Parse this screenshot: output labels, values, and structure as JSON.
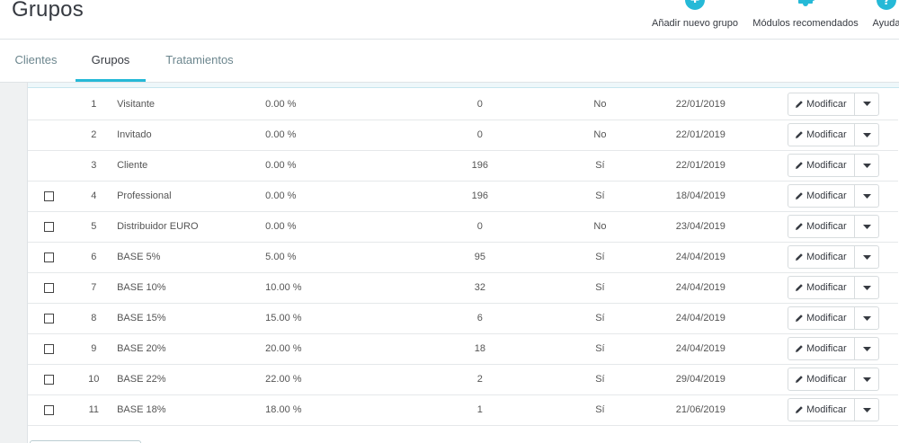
{
  "header": {
    "title": "Grupos",
    "toolbar": [
      {
        "label": "Añadir nuevo grupo",
        "icon": "add-circle-icon"
      },
      {
        "label": "Módulos recomendados",
        "icon": "puzzle-icon"
      },
      {
        "label": "Ayuda",
        "icon": "help-circle-icon"
      }
    ]
  },
  "tabs": [
    {
      "label": "Clientes"
    },
    {
      "label": "Grupos"
    },
    {
      "label": "Tratamientos"
    }
  ],
  "active_tab": "Grupos",
  "colors": {
    "accent": "#25b9d7",
    "toolbar_icon": "#25b9d7"
  },
  "table": {
    "edit_label": "Modificar",
    "rows": [
      {
        "id": "1",
        "name": "Visitante",
        "reduction": "0.00 %",
        "members": "0",
        "show_prices": "No",
        "date": "22/01/2019",
        "checkbox": false
      },
      {
        "id": "2",
        "name": "Invitado",
        "reduction": "0.00 %",
        "members": "0",
        "show_prices": "No",
        "date": "22/01/2019",
        "checkbox": false
      },
      {
        "id": "3",
        "name": "Cliente",
        "reduction": "0.00 %",
        "members": "196",
        "show_prices": "Sí",
        "date": "22/01/2019",
        "checkbox": false
      },
      {
        "id": "4",
        "name": "Professional",
        "reduction": "0.00 %",
        "members": "196",
        "show_prices": "Sí",
        "date": "18/04/2019",
        "checkbox": true
      },
      {
        "id": "5",
        "name": "Distribuidor EURO",
        "reduction": "0.00 %",
        "members": "0",
        "show_prices": "No",
        "date": "23/04/2019",
        "checkbox": true
      },
      {
        "id": "6",
        "name": "BASE 5%",
        "reduction": "5.00 %",
        "members": "95",
        "show_prices": "Sí",
        "date": "24/04/2019",
        "checkbox": true
      },
      {
        "id": "7",
        "name": "BASE 10%",
        "reduction": "10.00 %",
        "members": "32",
        "show_prices": "Sí",
        "date": "24/04/2019",
        "checkbox": true
      },
      {
        "id": "8",
        "name": "BASE 15%",
        "reduction": "15.00 %",
        "members": "6",
        "show_prices": "Sí",
        "date": "24/04/2019",
        "checkbox": true
      },
      {
        "id": "9",
        "name": "BASE 20%",
        "reduction": "20.00 %",
        "members": "18",
        "show_prices": "Sí",
        "date": "24/04/2019",
        "checkbox": true
      },
      {
        "id": "10",
        "name": "BASE 22%",
        "reduction": "22.00 %",
        "members": "2",
        "show_prices": "Sí",
        "date": "29/04/2019",
        "checkbox": true
      },
      {
        "id": "11",
        "name": "BASE 18%",
        "reduction": "18.00 %",
        "members": "1",
        "show_prices": "Sí",
        "date": "21/06/2019",
        "checkbox": true
      }
    ]
  }
}
